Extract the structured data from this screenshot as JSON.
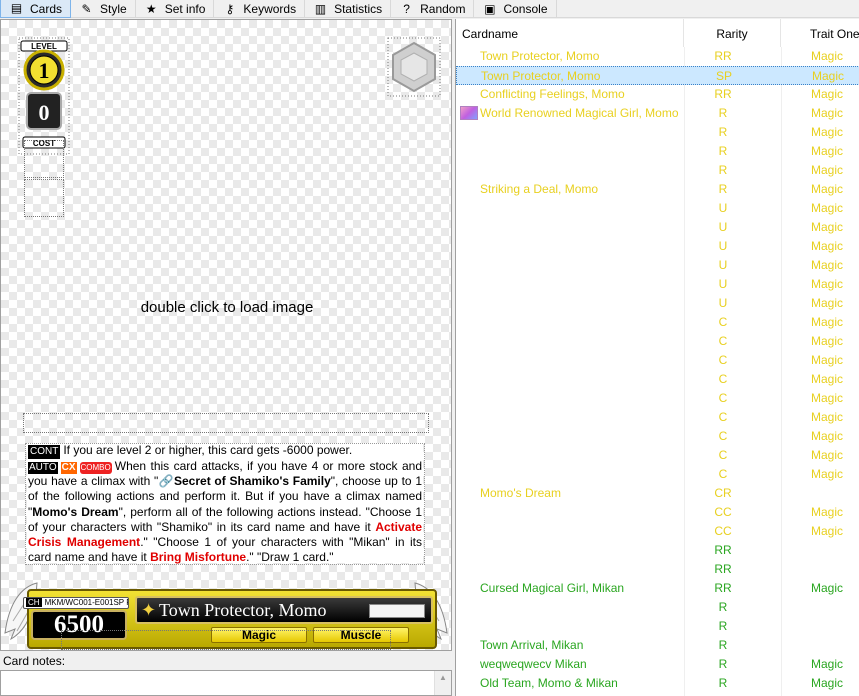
{
  "tabs": [
    {
      "label": "Cards",
      "icon": "cards-icon",
      "glyph": "▤",
      "active": true
    },
    {
      "label": "Style",
      "icon": "brush-icon",
      "glyph": "✎",
      "active": false
    },
    {
      "label": "Set info",
      "icon": "star-icon",
      "glyph": "★",
      "active": false
    },
    {
      "label": "Keywords",
      "icon": "key-icon",
      "glyph": "⚷",
      "active": false
    },
    {
      "label": "Statistics",
      "icon": "bar-chart-icon",
      "glyph": "▥",
      "active": false
    },
    {
      "label": "Random",
      "icon": "dice-icon",
      "glyph": "?",
      "active": false
    },
    {
      "label": "Console",
      "icon": "console-icon",
      "glyph": "▣",
      "active": false
    }
  ],
  "editor": {
    "load_message": "double click to load image",
    "level_badge": {
      "top_label": "LEVEL",
      "level": "1",
      "cost": "0",
      "bottom_label": "COST"
    },
    "effect_text": {
      "line1_tag": "CONT",
      "line1": "If you are level 2 or higher, this card gets -6000 power.",
      "auto_tag": "AUTO",
      "cx_tag": "CX",
      "combo_tag": "COMBO",
      "p1": "When this card attacks, if you have 4 or more stock and you have a climax with \"",
      "climax1": "🔗Secret of Shamiko's Family",
      "p2": "\", choose up to 1 of the following actions and perform it. But if you have a climax named \"",
      "climax2": "Momo's Dream",
      "p3": "\", perform all of the following actions instead. \"Choose 1 of your characters with \"Shamiko\" in its card name and have it ",
      "red1": "Activate Crisis Management",
      "p4": ".\" \"Choose 1 of your characters with \"Mikan\" in its card name and have it ",
      "red2": "Bring Misfortune",
      "p5": ".\" \"Draw 1 card.\""
    },
    "card": {
      "id_tag": "CH",
      "code": "MKM/WC001-E001SP RR",
      "power": "6500",
      "name": "Town Protector, Momo",
      "trait1": "Magic",
      "trait2": "Muscle"
    },
    "notes_label": "Card notes:"
  },
  "list": {
    "headers": [
      "Cardname",
      "Rarity",
      "Trait One"
    ],
    "rows": [
      {
        "name": "Town Protector, Momo",
        "rarity": "RR",
        "trait": "Magic",
        "color": "yel",
        "thumb": false,
        "selected": false
      },
      {
        "name": "Town Protector, Momo",
        "rarity": "SP",
        "trait": "Magic",
        "color": "yel",
        "thumb": false,
        "selected": true
      },
      {
        "name": "Conflicting Feelings, Momo",
        "rarity": "RR",
        "trait": "Magic",
        "color": "yel",
        "thumb": false,
        "selected": false
      },
      {
        "name": "World Renowned Magical Girl, Momo",
        "rarity": "R",
        "trait": "Magic",
        "color": "yel",
        "thumb": true,
        "selected": false
      },
      {
        "name": "",
        "rarity": "R",
        "trait": "Magic",
        "color": "yel",
        "thumb": false,
        "selected": false
      },
      {
        "name": "",
        "rarity": "R",
        "trait": "Magic",
        "color": "yel",
        "thumb": false,
        "selected": false
      },
      {
        "name": "",
        "rarity": "R",
        "trait": "Magic",
        "color": "yel",
        "thumb": false,
        "selected": false
      },
      {
        "name": "Striking a Deal, Momo",
        "rarity": "R",
        "trait": "Magic",
        "color": "yel",
        "thumb": false,
        "selected": false
      },
      {
        "name": "",
        "rarity": "U",
        "trait": "Magic",
        "color": "yel",
        "thumb": false,
        "selected": false
      },
      {
        "name": "",
        "rarity": "U",
        "trait": "Magic",
        "color": "yel",
        "thumb": false,
        "selected": false
      },
      {
        "name": "",
        "rarity": "U",
        "trait": "Magic",
        "color": "yel",
        "thumb": false,
        "selected": false
      },
      {
        "name": "",
        "rarity": "U",
        "trait": "Magic",
        "color": "yel",
        "thumb": false,
        "selected": false
      },
      {
        "name": "",
        "rarity": "U",
        "trait": "Magic",
        "color": "yel",
        "thumb": false,
        "selected": false
      },
      {
        "name": "",
        "rarity": "U",
        "trait": "Magic",
        "color": "yel",
        "thumb": false,
        "selected": false
      },
      {
        "name": "",
        "rarity": "C",
        "trait": "Magic",
        "color": "yel",
        "thumb": false,
        "selected": false
      },
      {
        "name": "",
        "rarity": "C",
        "trait": "Magic",
        "color": "yel",
        "thumb": false,
        "selected": false
      },
      {
        "name": "",
        "rarity": "C",
        "trait": "Magic",
        "color": "yel",
        "thumb": false,
        "selected": false
      },
      {
        "name": "",
        "rarity": "C",
        "trait": "Magic",
        "color": "yel",
        "thumb": false,
        "selected": false
      },
      {
        "name": "",
        "rarity": "C",
        "trait": "Magic",
        "color": "yel",
        "thumb": false,
        "selected": false
      },
      {
        "name": "",
        "rarity": "C",
        "trait": "Magic",
        "color": "yel",
        "thumb": false,
        "selected": false
      },
      {
        "name": "",
        "rarity": "C",
        "trait": "Magic",
        "color": "yel",
        "thumb": false,
        "selected": false
      },
      {
        "name": "",
        "rarity": "C",
        "trait": "Magic",
        "color": "yel",
        "thumb": false,
        "selected": false
      },
      {
        "name": "",
        "rarity": "C",
        "trait": "Magic",
        "color": "yel",
        "thumb": false,
        "selected": false
      },
      {
        "name": "Momo's Dream",
        "rarity": "CR",
        "trait": "",
        "color": "yel",
        "thumb": false,
        "selected": false
      },
      {
        "name": "",
        "rarity": "CC",
        "trait": "Magic",
        "color": "yel",
        "thumb": false,
        "selected": false
      },
      {
        "name": "",
        "rarity": "CC",
        "trait": "Magic",
        "color": "yel",
        "thumb": false,
        "selected": false
      },
      {
        "name": "",
        "rarity": "RR",
        "trait": "",
        "color": "grn",
        "thumb": false,
        "selected": false
      },
      {
        "name": "",
        "rarity": "RR",
        "trait": "",
        "color": "grn",
        "thumb": false,
        "selected": false
      },
      {
        "name": "Cursed Magical Girl, Mikan",
        "rarity": "RR",
        "trait": "Magic",
        "color": "grn",
        "thumb": false,
        "selected": false
      },
      {
        "name": "",
        "rarity": "R",
        "trait": "",
        "color": "grn",
        "thumb": false,
        "selected": false
      },
      {
        "name": "",
        "rarity": "R",
        "trait": "",
        "color": "grn",
        "thumb": false,
        "selected": false
      },
      {
        "name": "Town Arrival, Mikan",
        "rarity": "R",
        "trait": "",
        "color": "grn",
        "thumb": false,
        "selected": false
      },
      {
        "name": "weqweqwecv Mikan",
        "rarity": "R",
        "trait": "Magic",
        "color": "grn",
        "thumb": false,
        "selected": false
      },
      {
        "name": "Old Team, Momo & Mikan",
        "rarity": "R",
        "trait": "Magic",
        "color": "grn",
        "thumb": false,
        "selected": false
      }
    ]
  }
}
